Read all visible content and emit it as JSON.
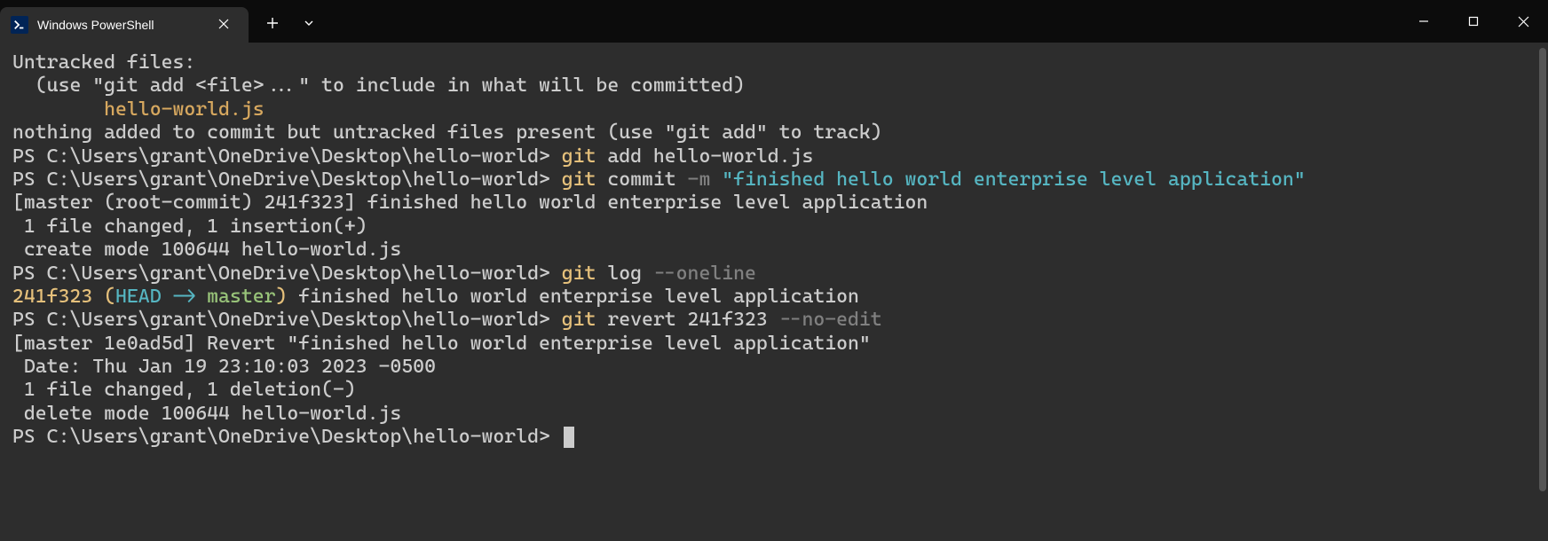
{
  "titlebar": {
    "tab_title": "Windows PowerShell"
  },
  "terminal": {
    "lines": [
      {
        "segments": [
          {
            "text": "Untracked files:",
            "cls": "c-default"
          }
        ]
      },
      {
        "segments": [
          {
            "text": "  (use \"git add <file>...\" to include in what will be committed)",
            "cls": "c-default"
          }
        ]
      },
      {
        "segments": [
          {
            "text": "        ",
            "cls": "c-default"
          },
          {
            "text": "hello-world.js",
            "cls": "c-orange"
          }
        ]
      },
      {
        "segments": [
          {
            "text": "",
            "cls": "c-default"
          }
        ]
      },
      {
        "segments": [
          {
            "text": "nothing added to commit but untracked files present (use \"git add\" to track)",
            "cls": "c-default"
          }
        ]
      },
      {
        "segments": [
          {
            "text": "PS C:\\Users\\grant\\OneDrive\\Desktop\\hello-world> ",
            "cls": "c-default"
          },
          {
            "text": "git ",
            "cls": "c-yellow"
          },
          {
            "text": "add hello-world.js",
            "cls": "c-default"
          }
        ]
      },
      {
        "segments": [
          {
            "text": "PS C:\\Users\\grant\\OneDrive\\Desktop\\hello-world> ",
            "cls": "c-default"
          },
          {
            "text": "git ",
            "cls": "c-yellow"
          },
          {
            "text": "commit ",
            "cls": "c-default"
          },
          {
            "text": "-m ",
            "cls": "c-gray"
          },
          {
            "text": "\"finished hello world enterprise level application\"",
            "cls": "c-cyan"
          }
        ]
      },
      {
        "segments": [
          {
            "text": "[master (root-commit) 241f323] finished hello world enterprise level application",
            "cls": "c-default"
          }
        ]
      },
      {
        "segments": [
          {
            "text": " 1 file changed, 1 insertion(+)",
            "cls": "c-default"
          }
        ]
      },
      {
        "segments": [
          {
            "text": " create mode 100644 hello-world.js",
            "cls": "c-default"
          }
        ]
      },
      {
        "segments": [
          {
            "text": "PS C:\\Users\\grant\\OneDrive\\Desktop\\hello-world> ",
            "cls": "c-default"
          },
          {
            "text": "git ",
            "cls": "c-yellow"
          },
          {
            "text": "log ",
            "cls": "c-default"
          },
          {
            "text": "--oneline",
            "cls": "c-gray"
          }
        ]
      },
      {
        "segments": [
          {
            "text": "241f323 ",
            "cls": "c-yellow"
          },
          {
            "text": "(",
            "cls": "c-yellow"
          },
          {
            "text": "HEAD -> ",
            "cls": "c-cyan"
          },
          {
            "text": "master",
            "cls": "c-green"
          },
          {
            "text": ")",
            "cls": "c-yellow"
          },
          {
            "text": " finished hello world enterprise level application",
            "cls": "c-default"
          }
        ]
      },
      {
        "segments": [
          {
            "text": "PS C:\\Users\\grant\\OneDrive\\Desktop\\hello-world> ",
            "cls": "c-default"
          },
          {
            "text": "git ",
            "cls": "c-yellow"
          },
          {
            "text": "revert 241f323 ",
            "cls": "c-default"
          },
          {
            "text": "--no-edit",
            "cls": "c-gray"
          }
        ]
      },
      {
        "segments": [
          {
            "text": "[master 1e0ad5d] Revert \"finished hello world enterprise level application\"",
            "cls": "c-default"
          }
        ]
      },
      {
        "segments": [
          {
            "text": " Date: Thu Jan 19 23:10:03 2023 -0500",
            "cls": "c-default"
          }
        ]
      },
      {
        "segments": [
          {
            "text": " 1 file changed, 1 deletion(-)",
            "cls": "c-default"
          }
        ]
      },
      {
        "segments": [
          {
            "text": " delete mode 100644 hello-world.js",
            "cls": "c-default"
          }
        ]
      },
      {
        "segments": [
          {
            "text": "PS C:\\Users\\grant\\OneDrive\\Desktop\\hello-world> ",
            "cls": "c-default"
          }
        ],
        "cursor": true
      }
    ]
  }
}
